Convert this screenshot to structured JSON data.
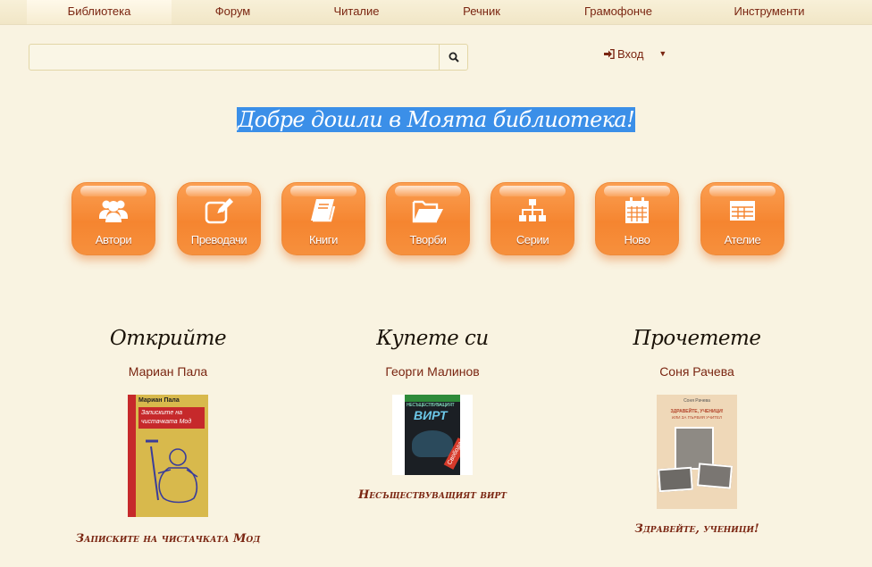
{
  "nav": {
    "items": [
      {
        "label": "Библиотека",
        "active": true
      },
      {
        "label": "Форум"
      },
      {
        "label": "Читалие"
      },
      {
        "label": "Речник"
      },
      {
        "label": "Грамофонче"
      },
      {
        "label": "Инструменти"
      }
    ]
  },
  "search": {
    "value": "",
    "placeholder": "",
    "icon": "search-icon"
  },
  "login": {
    "label": "Вход",
    "icon": "sign-in-icon",
    "caret_icon": "caret-down-icon"
  },
  "welcome": {
    "text": "Добре дошли в Моята библиотека!"
  },
  "sections": [
    {
      "label": "Автори",
      "icon": "users-icon"
    },
    {
      "label": "Преводачи",
      "icon": "edit-icon"
    },
    {
      "label": "Книги",
      "icon": "book-icon"
    },
    {
      "label": "Творби",
      "icon": "folder-open-icon"
    },
    {
      "label": "Серии",
      "icon": "sitemap-icon"
    },
    {
      "label": "Ново",
      "icon": "calendar-icon"
    },
    {
      "label": "Ателие",
      "icon": "table-icon"
    }
  ],
  "columns": [
    {
      "title": "Открийте",
      "author": "Мариан Пала",
      "book_title": "Записките на чистачката Мод",
      "cover": {
        "author": "Мариан Пала",
        "line1": "Записките на",
        "line2": "чистачката Мод",
        "bg": "#d8b94c",
        "band": "#c6292b"
      }
    },
    {
      "title": "Купете си",
      "author": "Георги Малинов",
      "book_title": "Несъществуващият вирт",
      "cover": {
        "line1": "НЕСЪЩЕСТВУВАЩИЯТ",
        "line2": "ВИРТ",
        "badge": "Свобода",
        "bg": "#1b1f24",
        "band": "#2e8b3a"
      }
    },
    {
      "title": "Прочетете",
      "author": "Соня Рачева",
      "book_title": "Здравейте, ученици!",
      "cover": {
        "author": "Соня Рачева",
        "line1": "ЗДРАВЕЙТЕ, УЧЕНИЦИ!",
        "line2": "ИЛИ ЗА ПЪРВИЯ УЧИТЕЛ",
        "bg": "#efd8b8"
      }
    }
  ],
  "colors": {
    "accent": "#f58530",
    "link": "#7a2511",
    "background": "#f9f3e1",
    "highlight": "#3b8fe8"
  }
}
